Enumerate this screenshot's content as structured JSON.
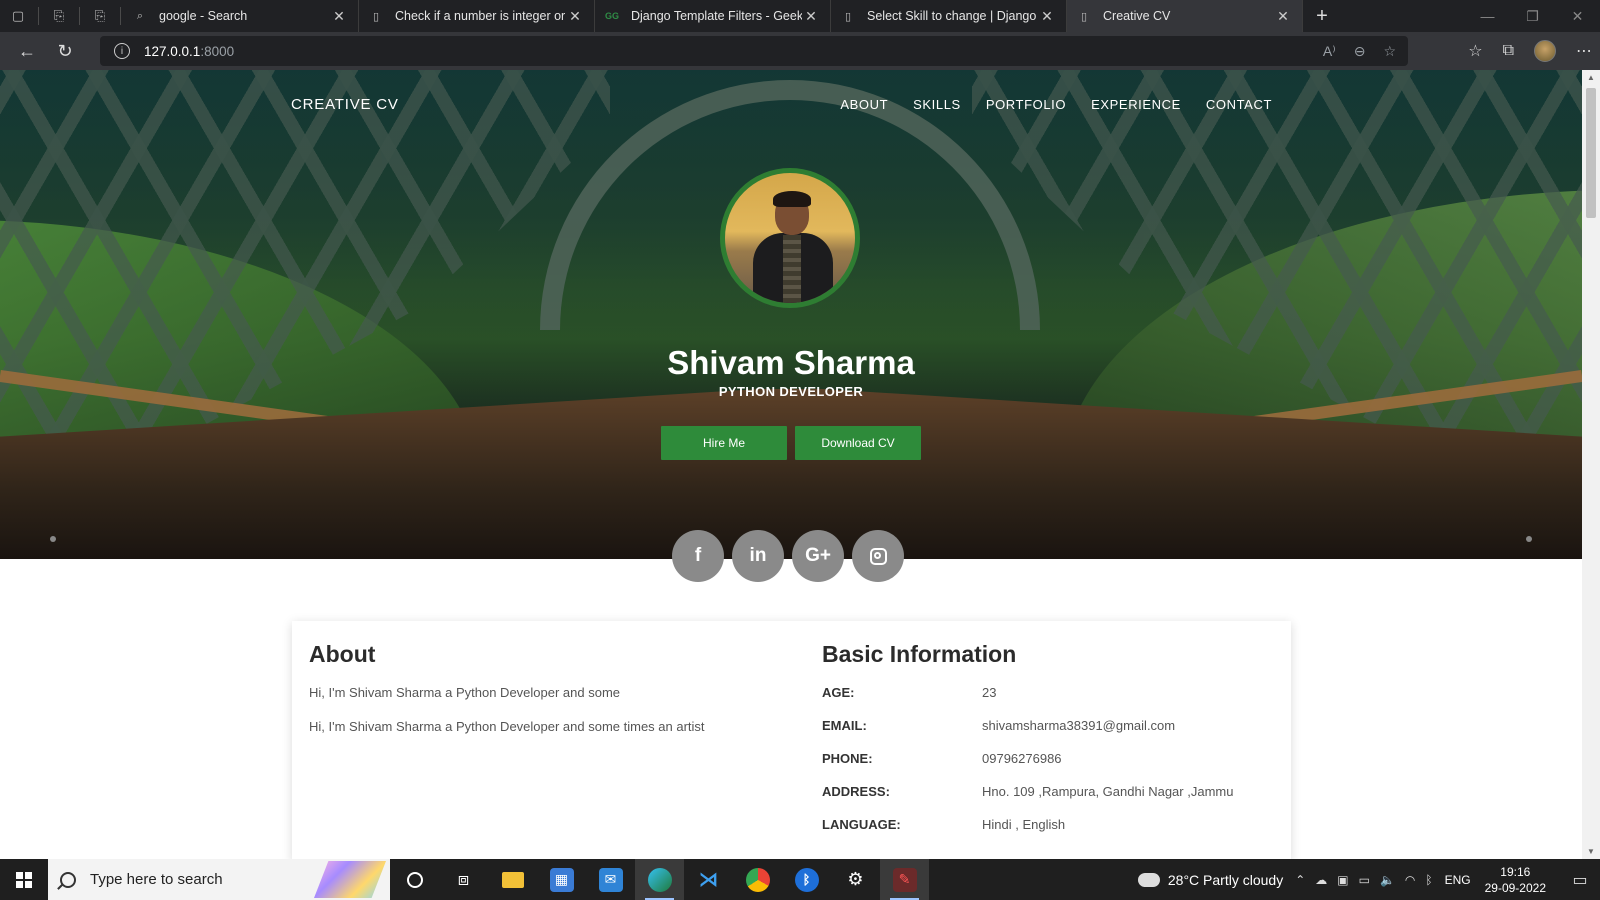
{
  "browser": {
    "tabs": [
      {
        "title": "google - Search",
        "favicon": "search-icon"
      },
      {
        "title": "Check if a number is integer or d",
        "favicon": "page-icon"
      },
      {
        "title": "Django Template Filters - Geeksf",
        "favicon": "gfg-icon"
      },
      {
        "title": "Select Skill to change | Django si",
        "favicon": "page-icon"
      },
      {
        "title": "Creative CV",
        "favicon": "page-icon",
        "active": true
      }
    ],
    "new_tab_label": "+",
    "url_host": "127.0.0.1",
    "url_port": ":8000",
    "url_security_icon": "info-icon"
  },
  "site": {
    "brand": "CREATIVE CV",
    "nav": [
      "ABOUT",
      "SKILLS",
      "PORTFOLIO",
      "EXPERIENCE",
      "CONTACT"
    ],
    "profile": {
      "name": "Shivam Sharma",
      "role": "PYTHON DEVELOPER",
      "hire_label": "Hire Me",
      "download_label": "Download CV"
    },
    "social": {
      "facebook": "f",
      "linkedin": "in",
      "googleplus": "G+"
    },
    "about": {
      "title": "About",
      "p1": "Hi, I'm Shivam Sharma a Python Developer and some",
      "p2": "Hi, I'm Shivam Sharma a Python Developer and some times an artist"
    },
    "basic": {
      "title": "Basic Information",
      "rows": [
        {
          "label": "AGE:",
          "value": "23"
        },
        {
          "label": "EMAIL:",
          "value": "shivamsharma38391@gmail.com"
        },
        {
          "label": "PHONE:",
          "value": "09796276986"
        },
        {
          "label": "ADDRESS:",
          "value": "Hno. 109 ,Rampura, Gandhi Nagar ,Jammu"
        },
        {
          "label": "LANGUAGE:",
          "value": "Hindi , English"
        }
      ]
    },
    "accent_color": "#2e8b3a"
  },
  "taskbar": {
    "search_placeholder": "Type here to search",
    "weather": "28°C  Partly cloudy",
    "lang": "ENG",
    "time": "19:16",
    "date": "29-09-2022"
  }
}
